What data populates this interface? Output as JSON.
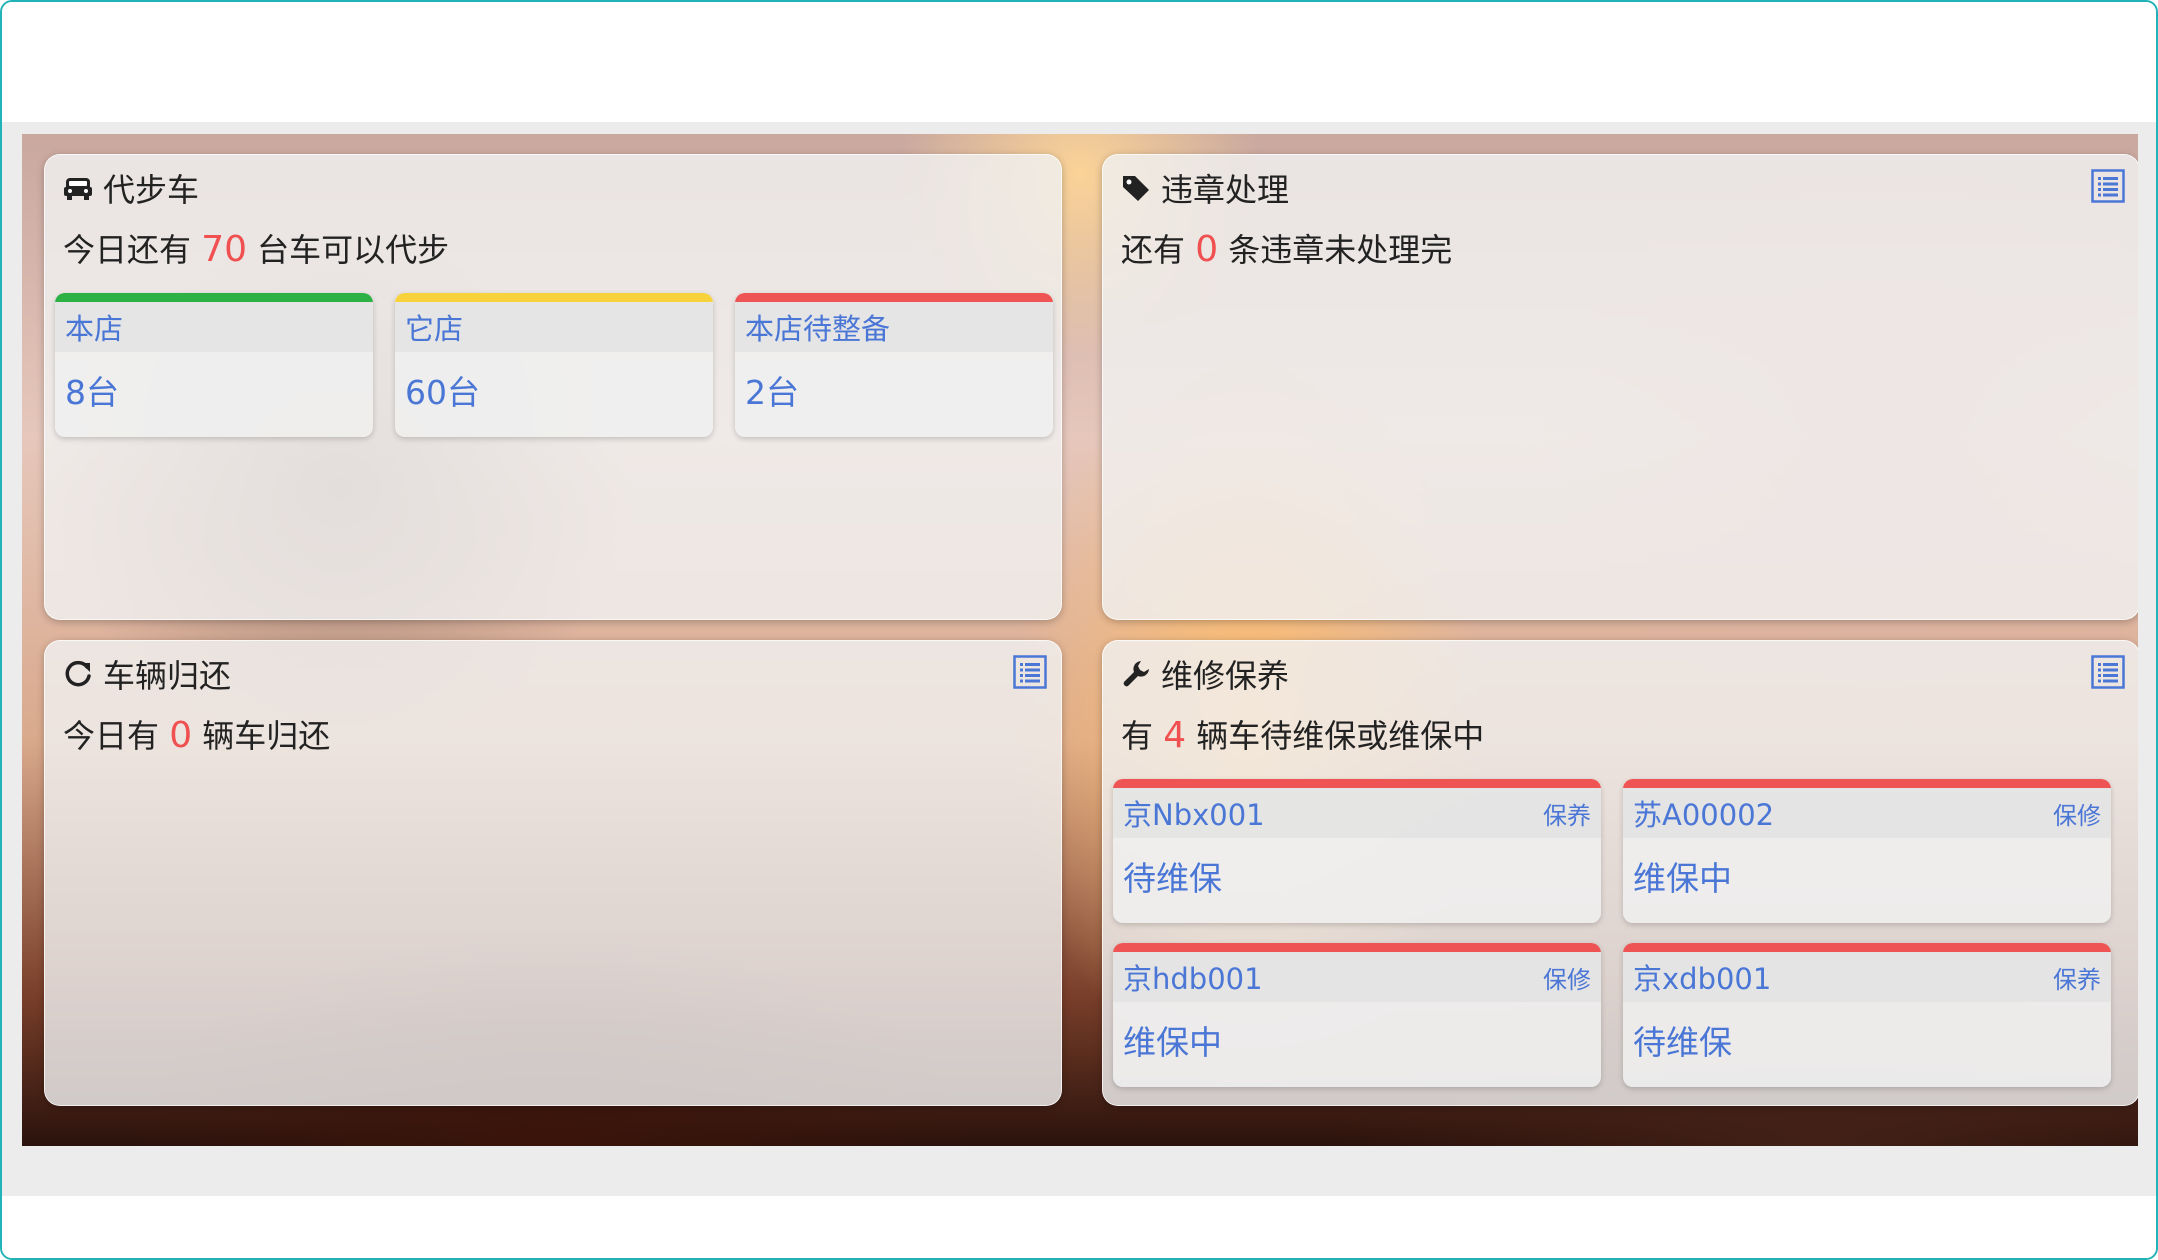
{
  "colors": {
    "accent_blue": "#4a76d6",
    "highlight_red": "#f05050",
    "green": "#2db144",
    "yellow": "#f7d23a",
    "red": "#ee5454",
    "frame": "#21b3b8"
  },
  "loaner": {
    "title": "代步车",
    "icon": "car-icon",
    "summary_prefix": "今日还有",
    "summary_count": "70",
    "summary_suffix": "台车可以代步",
    "tiles": [
      {
        "label": "本店",
        "value": "8台",
        "color": "#2db144"
      },
      {
        "label": "它店",
        "value": "60台",
        "color": "#f7d23a"
      },
      {
        "label": "本店待整备",
        "value": "2台",
        "color": "#ee5454"
      }
    ]
  },
  "violation": {
    "title": "违章处理",
    "icon": "tag-icon",
    "list_icon": "list-icon",
    "summary_prefix": "还有",
    "summary_count": "0",
    "summary_suffix": "条违章未处理完"
  },
  "return": {
    "title": "车辆归还",
    "icon": "refresh-icon",
    "list_icon": "list-icon",
    "summary_prefix": "今日有",
    "summary_count": "0",
    "summary_suffix": "辆车归还"
  },
  "maintenance": {
    "title": "维修保养",
    "icon": "wrench-icon",
    "list_icon": "list-icon",
    "summary_prefix": "有",
    "summary_count": "4",
    "summary_suffix": "辆车待维保或维保中",
    "tiles": [
      {
        "plate": "京Nbx001",
        "type": "保养",
        "status": "待维保"
      },
      {
        "plate": "苏A00002",
        "type": "保修",
        "status": "维保中"
      },
      {
        "plate": "京hdb001",
        "type": "保修",
        "status": "维保中"
      },
      {
        "plate": "京xdb001",
        "type": "保养",
        "status": "待维保"
      }
    ]
  }
}
